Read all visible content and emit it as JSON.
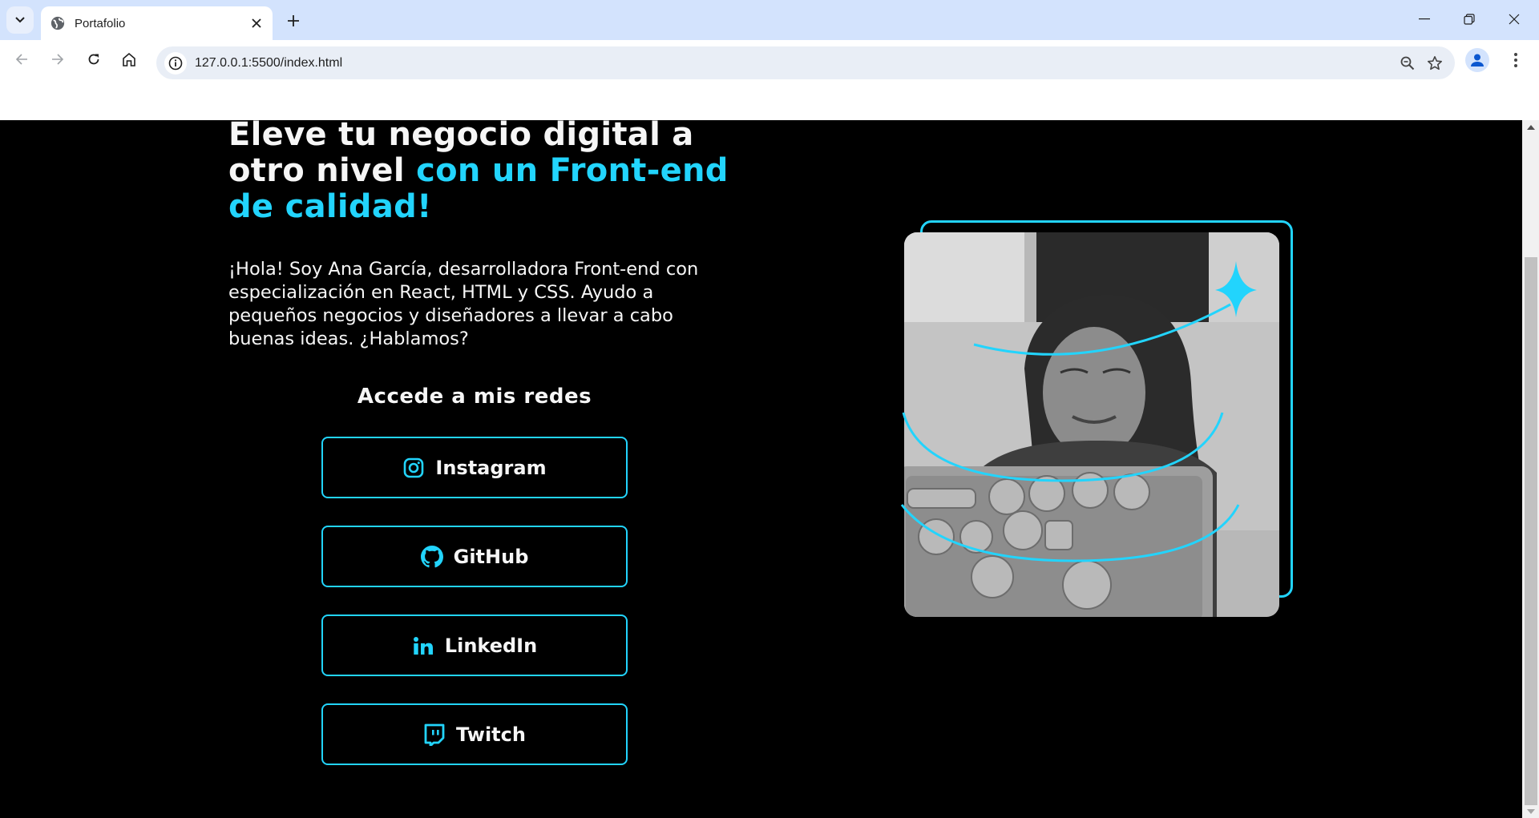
{
  "browser": {
    "tab": {
      "title": "Portafolio",
      "favicon": "globe-icon"
    },
    "new_tab_label": "+",
    "url": "127.0.0.1:5500/index.html",
    "toolbar_icons": [
      "back-icon",
      "forward-icon",
      "reload-icon",
      "home-icon",
      "site-info-icon",
      "zoom-out-icon",
      "bookmark-star-icon",
      "profile-icon",
      "more-menu-icon"
    ],
    "window_controls": [
      "minimize-icon",
      "restore-icon",
      "close-icon"
    ]
  },
  "hero": {
    "headline_white": "Eleve tu negocio digital a otro nivel ",
    "headline_accent": "con un Front-end de calidad!",
    "intro": "¡Hola! Soy Ana García, desarrolladora Front-end con especialización en React, HTML y CSS. Ayudo a pequeños negocios y diseñadores a llevar a cabo buenas ideas. ¿Hablamos?",
    "social_title": "Accede a mis redes",
    "social_links": [
      {
        "label": "Instagram",
        "icon": "instagram-icon"
      },
      {
        "label": "GitHub",
        "icon": "github-icon"
      },
      {
        "label": "LinkedIn",
        "icon": "linkedin-icon"
      },
      {
        "label": "Twitch",
        "icon": "twitch-icon"
      }
    ],
    "photo_alt": "Ana García con laptop",
    "colors": {
      "background": "#000000",
      "text": "#F6F6F6",
      "accent": "#22D4FD"
    }
  }
}
